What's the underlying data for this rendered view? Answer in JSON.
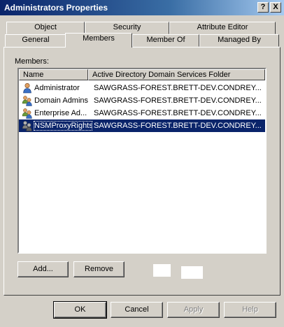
{
  "window": {
    "title": "Administrators Properties",
    "help_glyph": "?",
    "close_glyph": "X"
  },
  "tabs": {
    "row1": [
      "Object",
      "Security",
      "Attribute Editor"
    ],
    "row2": [
      "General",
      "Members",
      "Member Of",
      "Managed By"
    ],
    "active": "Members"
  },
  "members": {
    "label": "Members:",
    "columns": [
      "Name",
      "Active Directory Domain Services Folder"
    ],
    "rows": [
      {
        "name": "Administrator",
        "folder": "SAWGRASS-FOREST.BRETT-DEV.CONDREY...",
        "icon": "user-icon"
      },
      {
        "name": "Domain Admins",
        "folder": "SAWGRASS-FOREST.BRETT-DEV.CONDREY...",
        "icon": "group-icon"
      },
      {
        "name": "Enterprise Ad...",
        "folder": "SAWGRASS-FOREST.BRETT-DEV.CONDREY...",
        "icon": "group-icon"
      },
      {
        "name": "NSMProxyRights",
        "folder": "SAWGRASS-FOREST.BRETT-DEV.CONDREY...",
        "icon": "group-icon",
        "selected": true
      }
    ]
  },
  "actions": {
    "add": "Add...",
    "remove": "Remove"
  },
  "footer": {
    "ok": "OK",
    "cancel": "Cancel",
    "apply": "Apply",
    "help": "Help"
  }
}
